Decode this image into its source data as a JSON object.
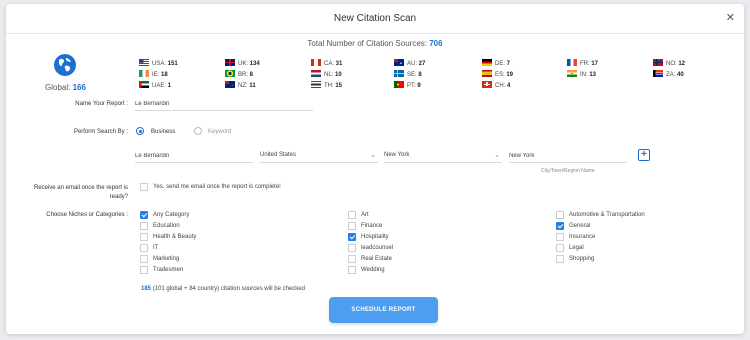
{
  "modal": {
    "title": "New Citation Scan",
    "close_glyph": "✕"
  },
  "total": {
    "label": "Total Number of Citation Sources:",
    "value": "706"
  },
  "global": {
    "label": "Global:",
    "value": "166"
  },
  "flags": [
    {
      "code": "us",
      "label": "USA:",
      "value": "151"
    },
    {
      "code": "uk",
      "label": "UK:",
      "value": "134"
    },
    {
      "code": "ca",
      "label": "CA:",
      "value": "31"
    },
    {
      "code": "au",
      "label": "AU:",
      "value": "27"
    },
    {
      "code": "de",
      "label": "DE:",
      "value": "7"
    },
    {
      "code": "fr",
      "label": "FR:",
      "value": "17"
    },
    {
      "code": "no",
      "label": "NO:",
      "value": "12"
    },
    {
      "code": "ie",
      "label": "IE:",
      "value": "18"
    },
    {
      "code": "br",
      "label": "BR:",
      "value": "8"
    },
    {
      "code": "nl",
      "label": "NL:",
      "value": "10"
    },
    {
      "code": "se",
      "label": "SE:",
      "value": "8"
    },
    {
      "code": "es",
      "label": "ES:",
      "value": "19"
    },
    {
      "code": "in",
      "label": "IN:",
      "value": "13"
    },
    {
      "code": "za",
      "label": "ZA:",
      "value": "40"
    },
    {
      "code": "ae",
      "label": "UAE:",
      "value": "1"
    },
    {
      "code": "nz",
      "label": "NZ:",
      "value": "11"
    },
    {
      "code": "th",
      "label": "TH:",
      "value": "15"
    },
    {
      "code": "pt",
      "label": "PT:",
      "value": "9"
    },
    {
      "code": "ch",
      "label": "CH:",
      "value": "4"
    }
  ],
  "form": {
    "report_label": "Name Your Report :",
    "report_value": "Le Bernardin",
    "search_label": "Perform Search By :",
    "radio_business": "Business",
    "radio_keyword": "Keyword",
    "business_value": "Le Bernardin",
    "country_value": "United States",
    "state_value": "New York",
    "city_value": "New York",
    "city_hint": "City/Town/Region Name",
    "plus_glyph": "+",
    "email_label_1": "Receive an email once the report is",
    "email_label_2": "ready?",
    "email_option": "Yes, send me email once the report is complete!",
    "niches_label": "Choose Niches or Categories :"
  },
  "categories": [
    {
      "label": "Any Category",
      "checked": true
    },
    {
      "label": "Art",
      "checked": false
    },
    {
      "label": "Automotive & Transportation",
      "checked": false
    },
    {
      "label": "Education",
      "checked": false
    },
    {
      "label": "Finance",
      "checked": false
    },
    {
      "label": "General",
      "checked": true
    },
    {
      "label": "Health & Beauty",
      "checked": false
    },
    {
      "label": "Hospitality",
      "checked": true
    },
    {
      "label": "Insurance",
      "checked": false
    },
    {
      "label": "IT",
      "checked": false
    },
    {
      "label": "leadcounsel",
      "checked": false
    },
    {
      "label": "Legal",
      "checked": false
    },
    {
      "label": "Marketing",
      "checked": false
    },
    {
      "label": "Real Estate",
      "checked": false
    },
    {
      "label": "Shopping",
      "checked": false
    },
    {
      "label": "Tradesmen",
      "checked": false
    },
    {
      "label": "Wedding",
      "checked": false
    }
  ],
  "summary": {
    "count": "185",
    "text": "(101 global + 84 country) citation sources will be checked"
  },
  "button": {
    "label": "SCHEDULE REPORT"
  },
  "colors": {
    "accent": "#1f6fd1",
    "button": "#4d9ef0"
  },
  "icons": {
    "globe": "globe-icon",
    "close": "close-icon",
    "plus": "plus-icon"
  }
}
